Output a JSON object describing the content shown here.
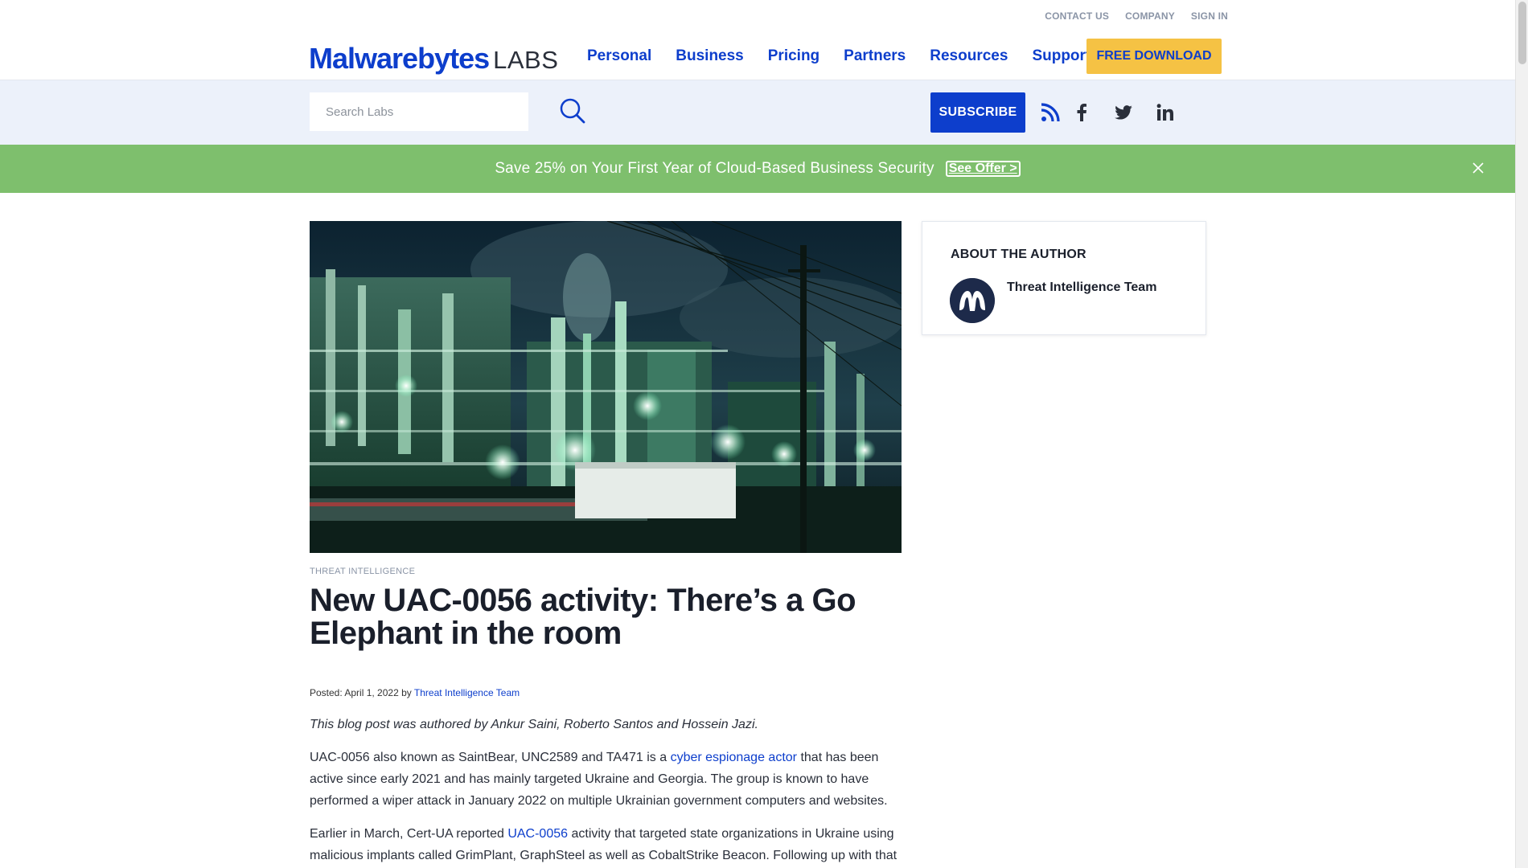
{
  "header": {
    "utility_links": [
      "CONTACT US",
      "COMPANY",
      "SIGN IN"
    ],
    "logo": {
      "brand": "Malwarebytes",
      "suffix": "LABS"
    },
    "nav": [
      "Personal",
      "Business",
      "Pricing",
      "Partners",
      "Resources",
      "Support"
    ],
    "cta_label": "FREE DOWNLOAD"
  },
  "search": {
    "placeholder": "Search Labs",
    "subscribe_label": "SUBSCRIBE",
    "social_icons": [
      "rss-icon",
      "facebook-icon",
      "twitter-icon",
      "linkedin-icon"
    ]
  },
  "promo": {
    "text": "Save 25% on Your First Year of Cloud-Based Business Security",
    "link_label": "See Offer >"
  },
  "article": {
    "category": "THREAT INTELLIGENCE",
    "title": "New UAC-0056 activity: There’s a Go Elephant in the room",
    "posted_label": "Posted:",
    "date": "April 1, 2022",
    "by_label": "by",
    "author": "Threat Intelligence Team",
    "byline_note": "This blog post was authored by Ankur Saini, Roberto Santos and Hossein Jazi.",
    "p1": {
      "before": "UAC-0056 also known as SaintBear, UNC2589 and TA471 is a",
      "link": "cyber espionage actor",
      "after": "that has been active since early 2021 and has mainly targeted Ukraine and Georgia. The group is known to have performed a wiper attack in January 2022 on multiple Ukrainian government computers and websites."
    },
    "p2": {
      "before": "Earlier in March, Cert-UA reported",
      "link": "UAC-0056",
      "after": "activity that targeted state organizations in Ukraine using malicious implants called GrimPlant, GraphSteel as well as CobaltStrike Beacon. Following up with that"
    }
  },
  "sidebar": {
    "heading": "ABOUT THE AUTHOR",
    "author_name": "Threat Intelligence Team"
  },
  "colors": {
    "brand_blue": "#0d3ecc",
    "cta_yellow": "#f5c244",
    "promo_green": "#7ebf6d",
    "search_band": "#ecf1fa"
  }
}
